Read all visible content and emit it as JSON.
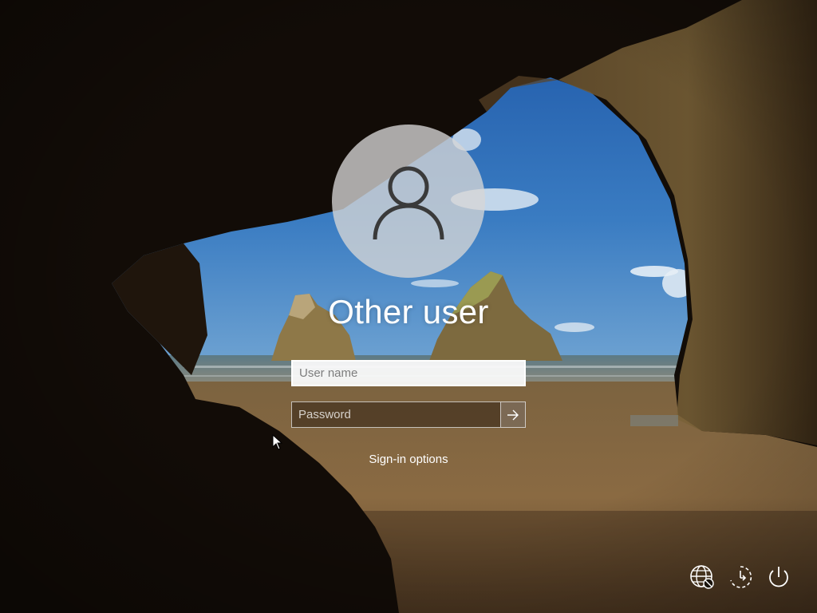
{
  "login": {
    "title": "Other user",
    "username_placeholder": "User name",
    "password_placeholder": "Password",
    "signin_options": "Sign-in options"
  },
  "icons": {
    "avatar": "user-silhouette-icon",
    "submit": "arrow-right-icon",
    "network": "network-globe-icon",
    "ease_of_access": "ease-of-access-icon",
    "power": "power-icon"
  },
  "colors": {
    "avatar_bg": "#d6d6d6",
    "text": "#ffffff",
    "sky": "#2f6fb4",
    "sand": "#8a6a42"
  }
}
